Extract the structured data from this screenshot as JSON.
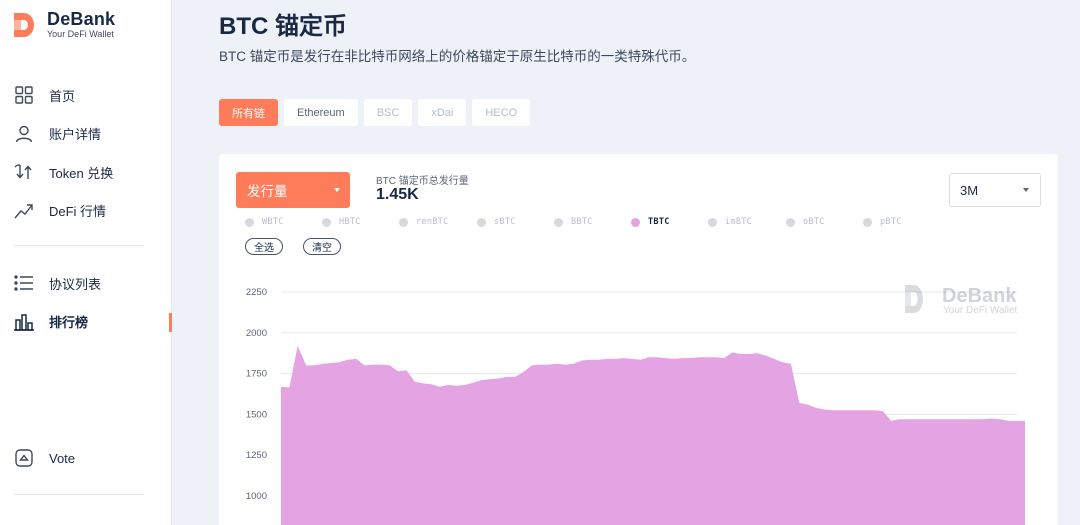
{
  "brand": {
    "name": "DeBank",
    "tagline": "Your DeFi Wallet",
    "accent": "#ff7c5b"
  },
  "sidebar": {
    "items": [
      {
        "label": "首页",
        "icon": "grid-icon"
      },
      {
        "label": "账户详情",
        "icon": "user-icon"
      },
      {
        "label": "Token 兑换",
        "icon": "swap-icon"
      },
      {
        "label": "DeFi 行情",
        "icon": "trend-icon"
      },
      {
        "label": "协议列表",
        "icon": "list-icon"
      },
      {
        "label": "排行榜",
        "icon": "bar-chart-icon"
      },
      {
        "label": "Vote",
        "icon": "vote-icon"
      }
    ]
  },
  "page": {
    "title": "BTC 锚定币",
    "description": "BTC 锚定币是发行在非比特币网络上的价格锚定于原生比特币的一类特殊代币。"
  },
  "chains": [
    {
      "label": "所有链",
      "state": "active"
    },
    {
      "label": "Ethereum",
      "state": "normal"
    },
    {
      "label": "BSC",
      "state": "disabled"
    },
    {
      "label": "xDai",
      "state": "disabled"
    },
    {
      "label": "HECO",
      "state": "disabled"
    }
  ],
  "card": {
    "metric_select": "发行量",
    "total_label": "BTC 锚定币总发行量",
    "total_value": "1.45K",
    "range_select": "3M",
    "select_all": "全选",
    "clear": "清空",
    "legend": [
      {
        "name": "WBTC",
        "on": false
      },
      {
        "name": "HBTC",
        "on": false
      },
      {
        "name": "renBTC",
        "on": false
      },
      {
        "name": "sBTC",
        "on": false
      },
      {
        "name": "BBTC",
        "on": false
      },
      {
        "name": "TBTC",
        "on": true
      },
      {
        "name": "imBTC",
        "on": false
      },
      {
        "name": "oBTC",
        "on": false
      },
      {
        "name": "pBTC",
        "on": false
      }
    ],
    "watermark": {
      "title": "DeBank",
      "subtitle": "Your DeFi Wallet"
    }
  },
  "chart_data": {
    "type": "area",
    "series": [
      {
        "name": "TBTC",
        "color": "#e4a3e2",
        "values": [
          1670,
          1665,
          1920,
          1800,
          1800,
          1810,
          1815,
          1820,
          1835,
          1840,
          1800,
          1805,
          1805,
          1800,
          1765,
          1770,
          1700,
          1690,
          1685,
          1670,
          1680,
          1675,
          1680,
          1695,
          1710,
          1715,
          1720,
          1730,
          1730,
          1760,
          1800,
          1805,
          1805,
          1810,
          1805,
          1810,
          1830,
          1835,
          1835,
          1840,
          1840,
          1845,
          1840,
          1835,
          1850,
          1850,
          1845,
          1840,
          1845,
          1845,
          1850,
          1850,
          1850,
          1845,
          1880,
          1870,
          1870,
          1875,
          1860,
          1840,
          1820,
          1810,
          1570,
          1560,
          1540,
          1530,
          1525,
          1525,
          1525,
          1525,
          1525,
          1525,
          1520,
          1460,
          1470,
          1470,
          1470,
          1470,
          1470,
          1470,
          1470,
          1470,
          1470,
          1470,
          1470,
          1475,
          1470,
          1460,
          1460,
          1460
        ]
      }
    ],
    "y_ticks": [
      1000,
      1250,
      1500,
      1750,
      2000,
      2250
    ],
    "ylim": [
      1000,
      2250
    ],
    "grid": true
  }
}
